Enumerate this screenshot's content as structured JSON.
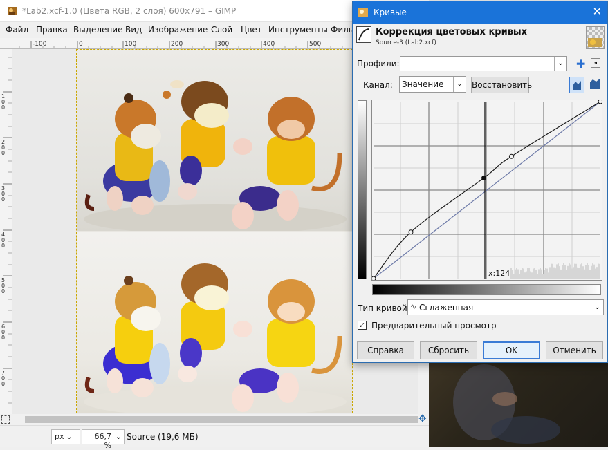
{
  "gimp": {
    "title": "*Lab2.xcf-1.0 (Цвета RGB, 2 слоя) 600x791 – GIMP",
    "menu": [
      "Файл",
      "Правка",
      "Выделение",
      "Вид",
      "Изображение",
      "Слой",
      "Цвет",
      "Инструменты",
      "Филь"
    ],
    "hruler_labels": [
      "-100",
      "0",
      "100",
      "200",
      "300",
      "400",
      "500"
    ],
    "vruler_labels": [
      "1\n0\n0",
      "2\n0\n0",
      "3\n0\n0",
      "4\n0\n0",
      "5\n0\n0",
      "6\n0\n0",
      "7\n0\n0"
    ],
    "status": {
      "unit": "px",
      "zoom": "66,7 %",
      "layer_info": "Source (19,6 МБ)"
    }
  },
  "dialog": {
    "title": "Кривые",
    "header_title": "Коррекция цветовых кривых",
    "header_subtitle": "Source-3 (Lab2.xcf)",
    "profiles_label": "Профили:",
    "profiles_value": "",
    "channel_label": "Канал:",
    "channel_value": "Значение",
    "reset_channel_label": "Восстановить",
    "cursor_readout": "x:124",
    "curve_type_label": "Тип кривой:",
    "curve_type_value": "Сглаженная",
    "preview_label": "Предварительный просмотр",
    "preview_checked": true,
    "buttons": {
      "help": "Справка",
      "reset": "Сбросить",
      "ok": "OK",
      "cancel": "Отменить"
    },
    "curve_points": [
      [
        0,
        0
      ],
      [
        42,
        67
      ],
      [
        124,
        145
      ],
      [
        155,
        176
      ],
      [
        255,
        255
      ]
    ]
  },
  "colors": {
    "title_blue": "#1a73d9",
    "accent": "#3a7bd5"
  }
}
